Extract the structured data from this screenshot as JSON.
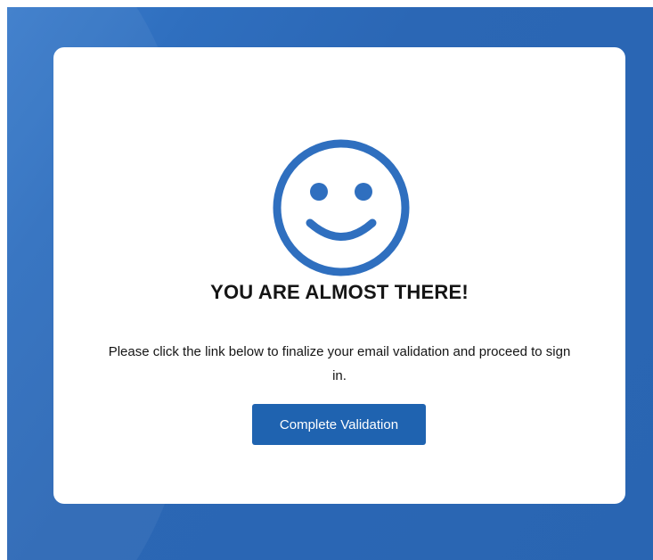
{
  "colors": {
    "background_blue": "#2965b2",
    "card": "#ffffff",
    "accent": "#2f6fbf",
    "button": "#1f63b0",
    "button_text": "#ffffff",
    "text": "#151515"
  },
  "card": {
    "icon": "smiley-face-icon",
    "headline": "YOU ARE ALMOST THERE!",
    "message": "Please click the link below to finalize your email validation and proceed to sign in.",
    "button_label": "Complete Validation"
  }
}
